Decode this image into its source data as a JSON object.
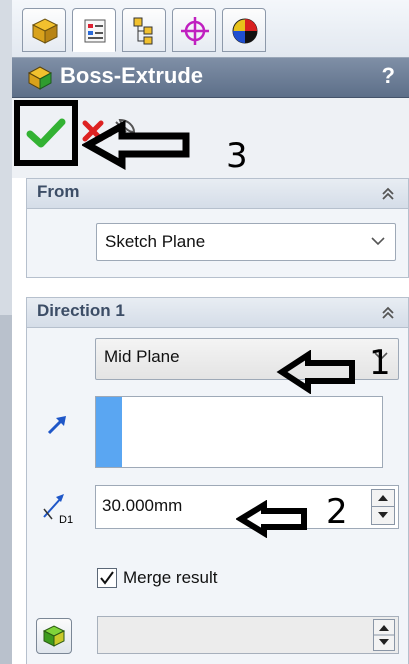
{
  "colors": {
    "title_bar": "#6c7d96",
    "selection_accent": "#5aa6f2",
    "ok_green": "#33b233",
    "cancel_red": "#d22"
  },
  "tabs": [
    {
      "name": "featuremanager-tab",
      "icon": "feature-tree-icon"
    },
    {
      "name": "propertymanager-tab",
      "icon": "property-manager-icon"
    },
    {
      "name": "configurationmanager-tab",
      "icon": "configuration-icon"
    },
    {
      "name": "dimxpert-tab",
      "icon": "crosshair-icon"
    },
    {
      "name": "display-manager-tab",
      "icon": "appearance-icon"
    }
  ],
  "header": {
    "title": "Boss-Extrude",
    "help": "?"
  },
  "actions": {
    "ok_icon": "check-icon",
    "cancel_icon": "close-icon",
    "pin_icon": "pushpin-icon"
  },
  "from_group": {
    "title": "From",
    "selected": "Sketch Plane"
  },
  "direction1": {
    "title": "Direction 1",
    "end_condition": "Mid Plane",
    "depth": "30.000mm",
    "depth_icon_label": "D1",
    "merge_result_label": "Merge result",
    "merge_result_checked": true
  },
  "annotations": {
    "ok_marker": "3",
    "end_condition_marker": "1",
    "depth_marker": "2"
  }
}
